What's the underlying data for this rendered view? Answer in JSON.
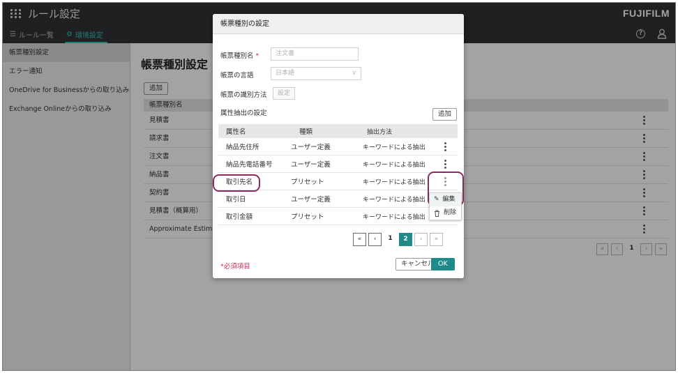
{
  "app": {
    "title": "ルール設定",
    "brand": "FUJIFILM",
    "tabs": [
      {
        "label": "ルール一覧",
        "icon": "list-icon"
      },
      {
        "label": "環境設定",
        "icon": "gear-icon"
      }
    ]
  },
  "sidebar": {
    "items": [
      {
        "label": "帳票種別設定"
      },
      {
        "label": "エラー通知"
      },
      {
        "label": "OneDrive for Businessからの取り込み"
      },
      {
        "label": "Exchange Onlineからの取り込み"
      }
    ]
  },
  "main": {
    "title": "帳票種別設定",
    "add_label": "追加",
    "table_header": "帳票種別名",
    "rows": [
      "見積書",
      "請求書",
      "注文書",
      "納品書",
      "契約書",
      "見積書（概算用）",
      "Approximate Estimate"
    ],
    "pager": {
      "first": "«",
      "prev": "‹",
      "page": "1",
      "next": "›",
      "last": "»"
    }
  },
  "dialog": {
    "title": "帳票種別の設定",
    "name_label": "帳票種別名",
    "required_mark": "*",
    "name_placeholder": "注文書",
    "language_label": "帳票の言語",
    "language_value": "日本語",
    "identify_label": "帳票の識別方法",
    "identify_button": "設定",
    "attr_section_label": "属性抽出の設定",
    "attr_add_label": "追加",
    "columns": [
      "属性名",
      "種類",
      "抽出方法"
    ],
    "attributes": [
      {
        "name": "納品先住所",
        "type": "ユーザー定義",
        "method": "キーワードによる抽出"
      },
      {
        "name": "納品先電話番号",
        "type": "ユーザー定義",
        "method": "キーワードによる抽出"
      },
      {
        "name": "取引先名",
        "type": "プリセット",
        "method": "キーワードによる抽出"
      },
      {
        "name": "取引日",
        "type": "ユーザー定義",
        "method": "キーワードによる抽出"
      },
      {
        "name": "取引金額",
        "type": "プリセット",
        "method": "キーワードによる抽出"
      }
    ],
    "context_menu": {
      "edit": "編集",
      "delete": "削除"
    },
    "pager": {
      "first": "«",
      "prev": "‹",
      "page1": "1",
      "page2": "2",
      "next": "›",
      "last": "»"
    },
    "required_note": "*必須項目",
    "cancel_label": "キャンセル",
    "ok_label": "OK"
  },
  "colors": {
    "accent": "#1f8a8a",
    "tab_active": "#3ac2b7",
    "highlight": "#8c2a5d",
    "appbar": "#2f3335"
  }
}
